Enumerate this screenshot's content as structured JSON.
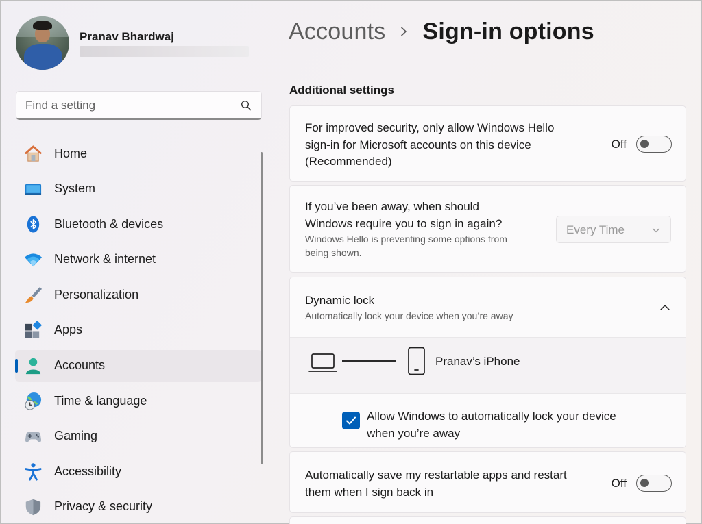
{
  "profile": {
    "name": "Pranav Bhardwaj"
  },
  "search": {
    "placeholder": "Find a setting"
  },
  "nav": {
    "items": [
      {
        "label": "Home",
        "icon": "home-icon"
      },
      {
        "label": "System",
        "icon": "system-icon"
      },
      {
        "label": "Bluetooth & devices",
        "icon": "bluetooth-icon"
      },
      {
        "label": "Network & internet",
        "icon": "wifi-icon"
      },
      {
        "label": "Personalization",
        "icon": "brush-icon"
      },
      {
        "label": "Apps",
        "icon": "apps-icon"
      },
      {
        "label": "Accounts",
        "icon": "person-icon",
        "selected": true
      },
      {
        "label": "Time & language",
        "icon": "globe-clock-icon"
      },
      {
        "label": "Gaming",
        "icon": "controller-icon"
      },
      {
        "label": "Accessibility",
        "icon": "accessibility-icon"
      },
      {
        "label": "Privacy & security",
        "icon": "shield-icon"
      }
    ]
  },
  "breadcrumb": {
    "parent": "Accounts",
    "current": "Sign-in options"
  },
  "section": {
    "title": "Additional settings"
  },
  "hello_only": {
    "line1": "For improved security, only allow Windows Hello",
    "line2": "sign-in for Microsoft accounts on this device",
    "line3": "(Recommended)",
    "state": "Off"
  },
  "require_signin": {
    "line1": "If you’ve been away, when should",
    "line2": "Windows require you to sign in again?",
    "note1": "Windows Hello is preventing some options from",
    "note2": "being shown.",
    "dropdown_value": "Every Time"
  },
  "dynamic_lock": {
    "title": "Dynamic lock",
    "subtitle": "Automatically lock your device when you’re away",
    "device_name": "Pranav’s iPhone",
    "checkbox_line1": "Allow Windows to automatically lock your device",
    "checkbox_line2": "when you’re away",
    "checkbox_checked": true
  },
  "restart_apps": {
    "line1": "Automatically save my restartable apps and restart",
    "line2": "them when I sign back in",
    "state": "Off"
  },
  "colors": {
    "accent": "#005fb8"
  }
}
